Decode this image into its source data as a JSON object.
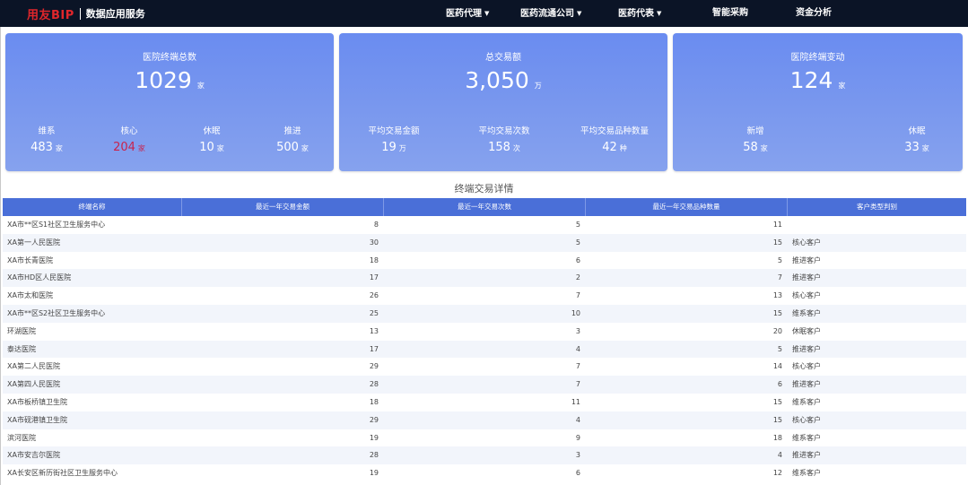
{
  "header": {
    "brand": "用友BIP",
    "subtitle": "数据应用服务",
    "nav": [
      {
        "label": "医药代理",
        "dropdown": true
      },
      {
        "label": "医药流通公司",
        "dropdown": true
      },
      {
        "label": "医药代表",
        "dropdown": true
      },
      {
        "label": "智能采购",
        "dropdown": false
      },
      {
        "label": "资金分析",
        "dropdown": false
      }
    ]
  },
  "cards": [
    {
      "title": "医院终端总数",
      "value": "1029",
      "unit": "家",
      "stats": [
        {
          "label": "维系",
          "value": "483",
          "unit": "家"
        },
        {
          "label": "核心",
          "value": "204",
          "unit": "家"
        },
        {
          "label": "休眠",
          "value": "10",
          "unit": "家"
        },
        {
          "label": "推进",
          "value": "500",
          "unit": "家"
        }
      ]
    },
    {
      "title": "总交易额",
      "value": "3,050",
      "unit": "万",
      "stats": [
        {
          "label": "平均交易金额",
          "value": "19",
          "unit": "万"
        },
        {
          "label": "平均交易次数",
          "value": "158",
          "unit": "次"
        },
        {
          "label": "平均交易品种数量",
          "value": "42",
          "unit": "种"
        }
      ]
    },
    {
      "title": "医院终端变动",
      "value": "124",
      "unit": "家",
      "stats": [
        {
          "label": "新增",
          "value": "58",
          "unit": "家"
        },
        {
          "label": "休眠",
          "value": "33",
          "unit": "家"
        }
      ]
    }
  ],
  "colors": {
    "highlight_value": "#c8234d",
    "card_bg": "#7596ee",
    "header_bg": "#0b1426",
    "table_head": "#4a6fd8"
  },
  "section_title": "终端交易详情",
  "table": {
    "columns": [
      "终端名称",
      "最近一年交易金额",
      "最近一年交易次数",
      "最近一年交易品种数量",
      "客户类型判别"
    ],
    "rows": [
      [
        "XA市**区S1社区卫生服务中心",
        "8",
        "5",
        "11",
        ""
      ],
      [
        "XA第一人民医院",
        "30",
        "5",
        "15",
        "核心客户"
      ],
      [
        "XA市长青医院",
        "18",
        "6",
        "5",
        "推进客户"
      ],
      [
        "XA市HD区人民医院",
        "17",
        "2",
        "7",
        "推进客户"
      ],
      [
        "XA市太和医院",
        "26",
        "7",
        "13",
        "核心客户"
      ],
      [
        "XA市**区S2社区卫生服务中心",
        "25",
        "10",
        "15",
        "维系客户"
      ],
      [
        "环湖医院",
        "13",
        "3",
        "20",
        "休眠客户"
      ],
      [
        "泰达医院",
        "17",
        "4",
        "5",
        "推进客户"
      ],
      [
        "XA第二人民医院",
        "29",
        "7",
        "14",
        "核心客户"
      ],
      [
        "XA第四人民医院",
        "28",
        "7",
        "6",
        "推进客户"
      ],
      [
        "XA市板桥镇卫生院",
        "18",
        "11",
        "15",
        "维系客户"
      ],
      [
        "XA市砚港镇卫生院",
        "29",
        "4",
        "15",
        "核心客户"
      ],
      [
        "滨河医院",
        "19",
        "9",
        "18",
        "维系客户"
      ],
      [
        "XA市安吉尔医院",
        "28",
        "3",
        "4",
        "推进客户"
      ],
      [
        "XA长安区新历街社区卫生服务中心",
        "19",
        "6",
        "12",
        "维系客户"
      ]
    ]
  }
}
